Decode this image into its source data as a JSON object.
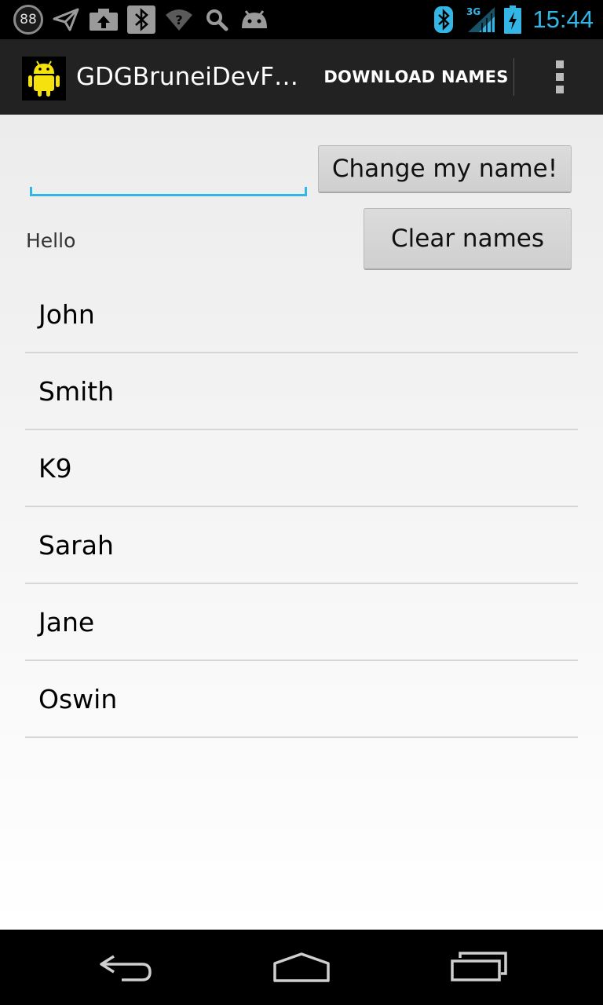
{
  "status_bar": {
    "notification_badge": "88",
    "time": "15:44",
    "network": "3G",
    "accent_color": "#33b5e5",
    "icons": [
      "notification-88-icon",
      "send-icon",
      "upload-icon",
      "bluetooth-icon",
      "wifi-question-icon",
      "search-icon",
      "android-head-icon",
      "bluetooth-icon",
      "signal-3g-icon",
      "battery-charging-icon"
    ]
  },
  "action_bar": {
    "title": "GDGBruneiDevF…",
    "download_label": "DOWNLOAD NAMES",
    "icon": "android-robot-icon",
    "overflow_icon": "overflow-menu-icon"
  },
  "form": {
    "name_input_value": "",
    "change_name_label": "Change my name!",
    "clear_names_label": "Clear names",
    "greeting": "Hello"
  },
  "names": [
    "John",
    "Smith",
    "K9",
    "Sarah",
    "Jane",
    "Oswin"
  ],
  "nav_bar": {
    "icons": [
      "back-icon",
      "home-icon",
      "recent-apps-icon"
    ]
  }
}
